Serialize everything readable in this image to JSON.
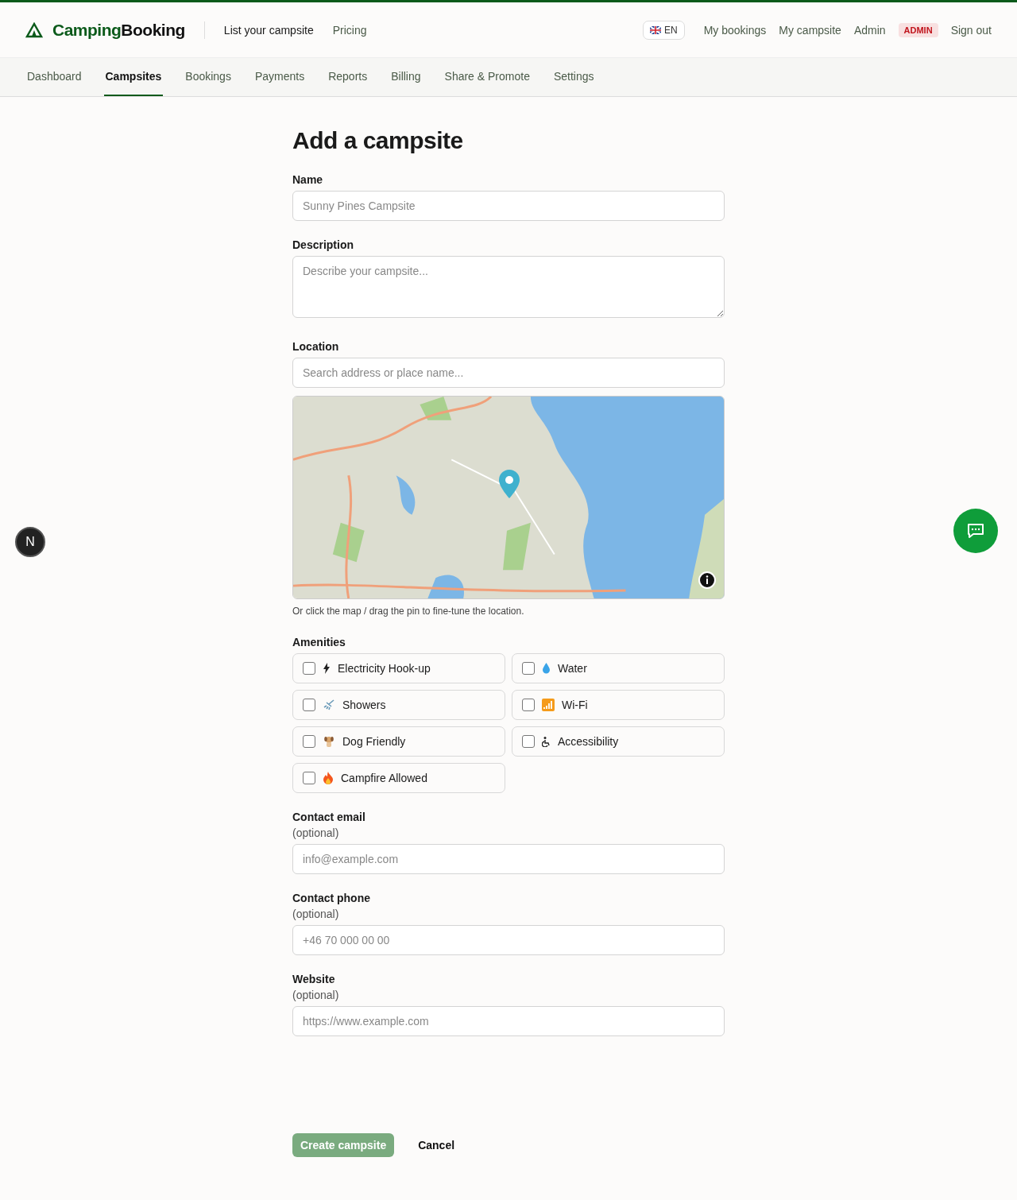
{
  "header": {
    "brand_lead": "Camping",
    "brand_rest": "Booking",
    "links": [
      {
        "label": "List your campsite",
        "selected": true
      },
      {
        "label": "Pricing",
        "selected": false
      }
    ],
    "language": "EN",
    "user_links": [
      "My bookings",
      "My campsite",
      "Admin"
    ],
    "role_badge": "ADMIN",
    "sign_out": "Sign out"
  },
  "tabs": [
    {
      "label": "Dashboard",
      "selected": false
    },
    {
      "label": "Campsites",
      "selected": true
    },
    {
      "label": "Bookings",
      "selected": false
    },
    {
      "label": "Payments",
      "selected": false
    },
    {
      "label": "Reports",
      "selected": false
    },
    {
      "label": "Billing",
      "selected": false
    },
    {
      "label": "Share & Promote",
      "selected": false
    },
    {
      "label": "Settings",
      "selected": false
    }
  ],
  "form": {
    "title": "Add a campsite",
    "name": {
      "label": "Name",
      "placeholder": "Sunny Pines Campsite"
    },
    "description": {
      "label": "Description",
      "placeholder": "Describe your campsite..."
    },
    "location": {
      "label": "Location",
      "placeholder": "Search address or place name...",
      "hint": "Or click the map / drag the pin to fine-tune the location."
    },
    "amenities": {
      "label": "Amenities",
      "items": [
        {
          "label": "Electricity Hook-up",
          "checked": false
        },
        {
          "label": "Water",
          "checked": false
        },
        {
          "label": "Showers",
          "checked": false
        },
        {
          "label": "Wi-Fi",
          "checked": false
        },
        {
          "label": "Dog Friendly",
          "checked": false
        },
        {
          "label": "Accessibility",
          "checked": false
        },
        {
          "label": "Campfire Allowed",
          "checked": false
        }
      ]
    },
    "contact_fields": [
      {
        "label": "Contact email",
        "note": "(optional)",
        "placeholder": "info@example.com"
      },
      {
        "label": "Contact phone",
        "note": "(optional)",
        "placeholder": "+46 70 000 00 00"
      },
      {
        "label": "Website",
        "note": "(optional)",
        "placeholder": "https://www.example.com"
      }
    ],
    "submit": {
      "label": "Create campsite",
      "disabled": true
    },
    "cancel": "Cancel"
  },
  "dev_badge": "N"
}
